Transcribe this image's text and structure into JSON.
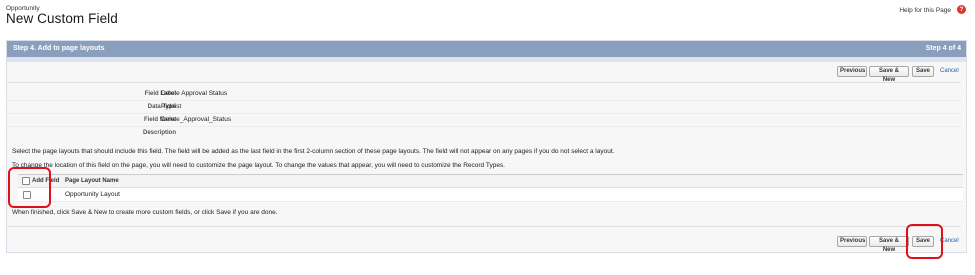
{
  "header": {
    "breadcrumb": "Opportunity",
    "title": "New Custom Field",
    "help_link": "Help for this Page",
    "help_icon": "?"
  },
  "panel": {
    "step_title": "Step 4. Add to page layouts",
    "step_count": "Step 4 of 4",
    "header_color": "#8a9ebe"
  },
  "toolbar": {
    "previous_label": "Previous",
    "save_new_label": "Save & New",
    "save_label": "Save",
    "cancel_label": "Cancel"
  },
  "bottom_toolbar": {
    "cancel_label": "Cancel"
  },
  "details": [
    {
      "label": "Field Label",
      "value": "Delete Approval Status"
    },
    {
      "label": "Data Type",
      "value": "Picklist"
    },
    {
      "label": "Field Name",
      "value": "Delete_Approval_Status"
    },
    {
      "label": "Description",
      "value": ""
    }
  ],
  "instructions": {
    "line1": "Select the page layouts that should include this field. The field will be added as the last field in the first 2-column section of these page layouts. The field will not appear on any pages if you do not select a layout.",
    "line2": "To change the location of this field on the page, you will need to customize the page layout. To change the values that appear, you will need to customize the Record Types.",
    "finish": "When finished, click Save & New to create more custom fields, or click Save if you are done."
  },
  "layout_table": {
    "columns": [
      "Add Field",
      "Page Layout Name"
    ],
    "rows": [
      {
        "checked": false,
        "name": "Opportunity Layout"
      }
    ]
  },
  "annotation_color": "#e0101a"
}
